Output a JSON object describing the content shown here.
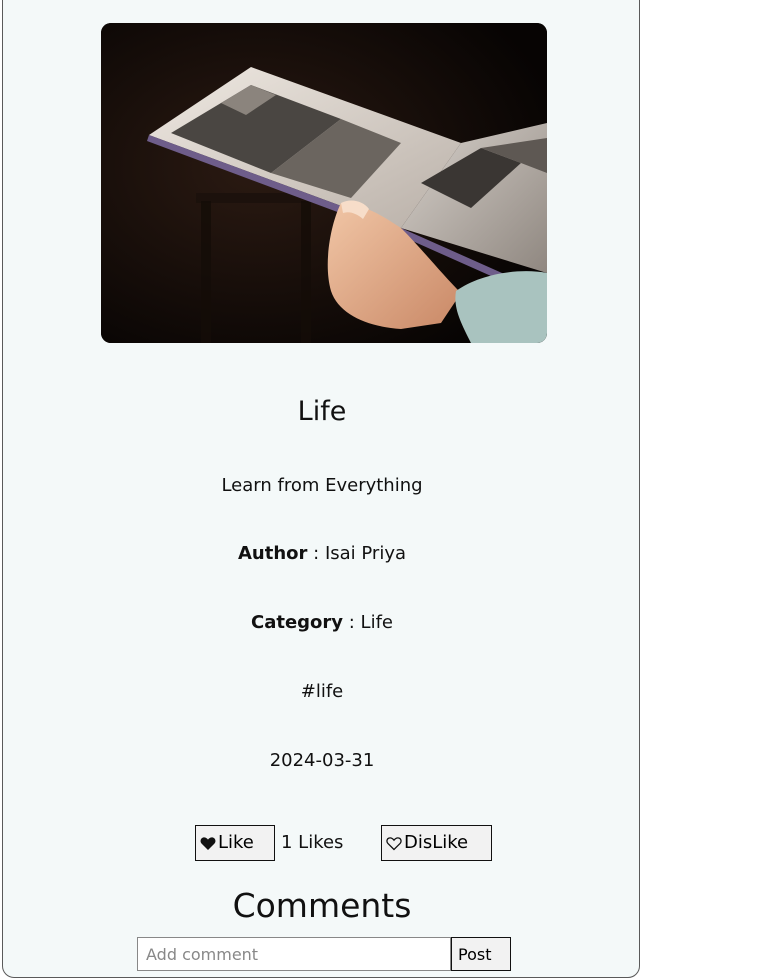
{
  "post": {
    "title": "Life",
    "subtitle": "Learn from Everything",
    "author_label": "Author",
    "author_separator": " : ",
    "author": "Isai Priya",
    "category_label": "Category",
    "category_separator": " : ",
    "category": "Life",
    "tag": "#life",
    "date": "2024-03-31",
    "image_icon": "photo-of-hand-holding-open-magazine"
  },
  "actions": {
    "like_label": "Like",
    "like_icon": "heart-filled-icon",
    "likes_count": "1 Likes",
    "dislike_label": "DisLike",
    "dislike_icon": "heart-outline-icon"
  },
  "comments": {
    "heading": "Comments",
    "input_placeholder": "Add comment",
    "post_label": "Post"
  },
  "colors": {
    "card_background": "#f4f9f9",
    "card_border": "#5a5a5a",
    "button_background": "#f2f2f2"
  }
}
